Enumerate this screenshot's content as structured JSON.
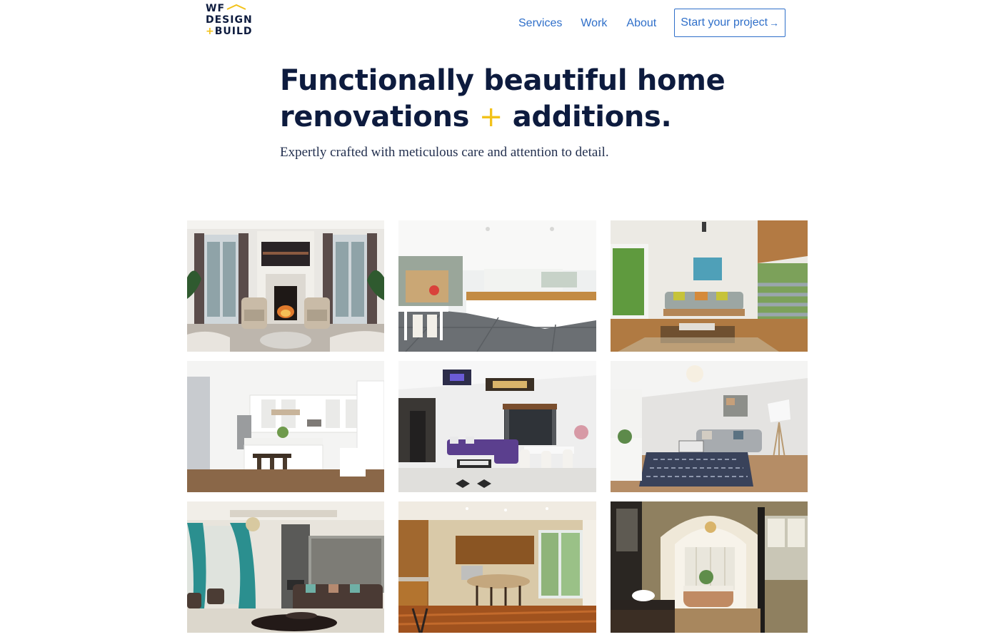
{
  "logo": {
    "line1": "WF",
    "line2": "DESIGN",
    "line3_plus": "+",
    "line3": "BUILD"
  },
  "nav": {
    "services": "Services",
    "work": "Work",
    "about": "About",
    "cta_label": "Start your project",
    "cta_arrow": "→"
  },
  "hero": {
    "title_line1": "Functionally beautiful home",
    "title_line2_a": "renovations",
    "title_plus": "+",
    "title_line2_b": "additions.",
    "subtitle": "Expertly crafted with meticulous care and attention to detail."
  },
  "colors": {
    "navy": "#0d1b3e",
    "link_blue": "#2f6fc9",
    "accent_yellow": "#f2c21b"
  },
  "gallery": {
    "tiles": [
      {
        "name": "living-room-fireplace-photo"
      },
      {
        "name": "white-kitchen-slate-floor-photo"
      },
      {
        "name": "sunroom-sofa-photo"
      },
      {
        "name": "kitchen-island-photo"
      },
      {
        "name": "living-dining-purple-sofa-photo"
      },
      {
        "name": "grey-sofa-living-room-photo"
      },
      {
        "name": "teal-curtain-living-room-photo"
      },
      {
        "name": "wood-kitchen-bar-photo"
      },
      {
        "name": "arched-bathroom-photo"
      }
    ]
  }
}
